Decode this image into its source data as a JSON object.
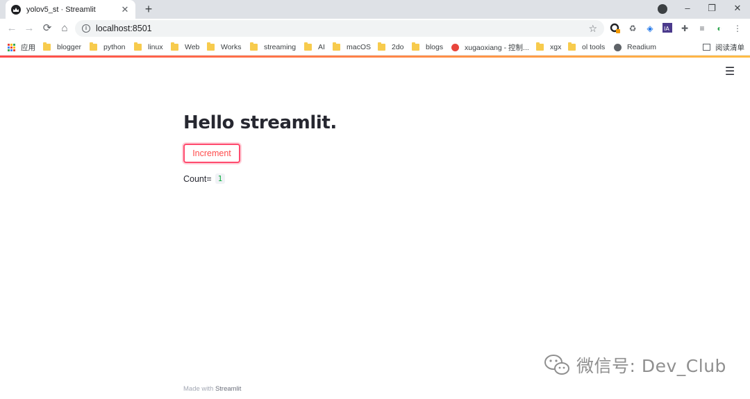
{
  "browser": {
    "tab": {
      "title": "yolov5_st · Streamlit",
      "favicon": "streamlit-crown-icon"
    },
    "new_tab_label": "+",
    "window_controls": {
      "minimize": "–",
      "restore": "❐",
      "close": "✕"
    },
    "toolbar": {
      "back": "←",
      "forward": "→",
      "reload": "⟳",
      "home": "⌂",
      "url": "localhost:8501",
      "bookmark_star": "☆",
      "menu": "⋮"
    },
    "bookmarks": [
      {
        "label": "应用",
        "icon": "apps-grid-icon"
      },
      {
        "label": "blogger",
        "icon": "folder-icon"
      },
      {
        "label": "python",
        "icon": "folder-icon"
      },
      {
        "label": "linux",
        "icon": "folder-icon"
      },
      {
        "label": "Web",
        "icon": "folder-icon"
      },
      {
        "label": "Works",
        "icon": "folder-icon"
      },
      {
        "label": "streaming",
        "icon": "folder-icon"
      },
      {
        "label": "AI",
        "icon": "folder-icon"
      },
      {
        "label": "macOS",
        "icon": "folder-icon"
      },
      {
        "label": "2do",
        "icon": "folder-icon"
      },
      {
        "label": "blogs",
        "icon": "folder-icon"
      },
      {
        "label": "xugaoxiang - 控制...",
        "icon": "gear-red-icon"
      },
      {
        "label": "xgx",
        "icon": "folder-icon"
      },
      {
        "label": "ol tools",
        "icon": "folder-icon"
      },
      {
        "label": "Readium",
        "icon": "globe-icon"
      }
    ],
    "reading_list": "阅读清单",
    "accent_colors": [
      "#ff4b4b",
      "#ffbd45"
    ]
  },
  "app": {
    "menu_icon": "☰",
    "title": "Hello streamlit.",
    "button_label": "Increment",
    "count_label": "Count=",
    "count_value": "1",
    "footer_prefix": "Made with",
    "footer_brand": "Streamlit",
    "accent_color": "#ff4b4b"
  },
  "watermark": {
    "text": "微信号: Dev_Club",
    "icon": "wechat-icon"
  }
}
